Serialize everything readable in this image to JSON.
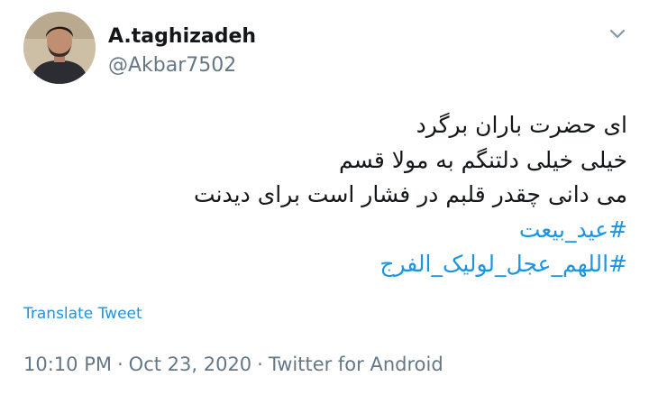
{
  "user": {
    "display_name": "A.taghizadeh",
    "handle": "@Akbar7502"
  },
  "tweet": {
    "lines": [
      "ای حضرت باران برگرد",
      "خیلی خیلی دلتنگم به مولا قسم",
      "می دانی چقدر قلبم در فشار است برای دیدنت"
    ],
    "hashtags": [
      "#عید_بیعت",
      "#اللهم_عجل_لولیک_الفرج"
    ]
  },
  "translate_label": "Translate Tweet",
  "meta": {
    "time": "10:10 PM",
    "date": "Oct 23, 2020",
    "source": "Twitter for Android",
    "separator": "·"
  },
  "icons": {
    "menu": "chevron-down-icon"
  },
  "colors": {
    "text": "#14171a",
    "secondary": "#657786",
    "link": "#1b95e0"
  }
}
